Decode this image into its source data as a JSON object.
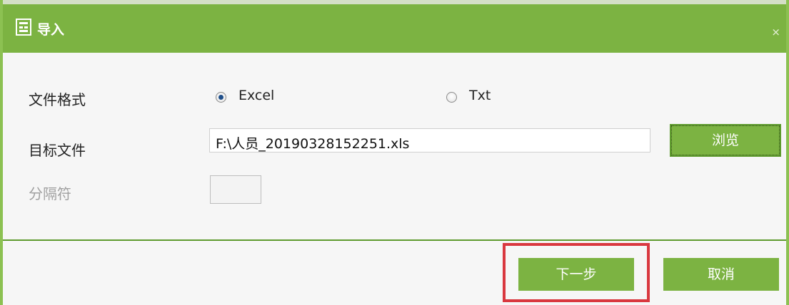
{
  "dialog": {
    "title": "导入",
    "close_label": "×"
  },
  "form": {
    "format_label": "文件格式",
    "format_options": [
      {
        "label": "Excel",
        "checked": true
      },
      {
        "label": "Txt",
        "checked": false
      }
    ],
    "target_file_label": "目标文件",
    "target_file_value": "F:\\人员_20190328152251.xls",
    "browse_label": "浏览",
    "separator_label": "分隔符",
    "separator_value": ""
  },
  "footer": {
    "next_label": "下一步",
    "cancel_label": "取消"
  },
  "colors": {
    "accent": "#7cb342",
    "highlight": "#d9383f"
  }
}
